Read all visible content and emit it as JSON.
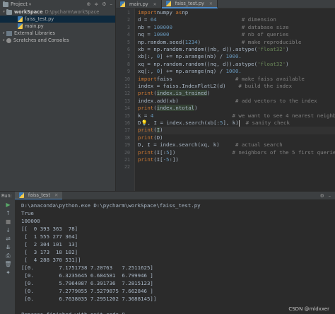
{
  "project": {
    "title": "Project",
    "tree": [
      {
        "label": "workSpace",
        "path": "D:\\pycharm\\workSpace",
        "type": "folder",
        "expanded": true,
        "bold": true
      },
      {
        "label": "faiss_test.py",
        "type": "py",
        "selected": true
      },
      {
        "label": "main.py",
        "type": "py"
      },
      {
        "label": "External Libraries",
        "type": "libs"
      },
      {
        "label": "Scratches and Consoles",
        "type": "scratch"
      }
    ]
  },
  "editor": {
    "tabs": [
      {
        "label": "main.py",
        "active": false
      },
      {
        "label": "faiss_test.py",
        "active": true
      }
    ],
    "current_line": 17,
    "lines": [
      [
        [
          "kw",
          "import"
        ],
        [
          "",
          "numpy "
        ],
        [
          "kw",
          "as"
        ],
        [
          "",
          "np"
        ]
      ],
      [
        [
          "",
          "d = "
        ],
        [
          "num",
          "64"
        ],
        [
          "",
          "                           "
        ],
        [
          "cm",
          "# dimension"
        ]
      ],
      [
        [
          "",
          "nb = "
        ],
        [
          "num",
          "100000"
        ],
        [
          "",
          "                      "
        ],
        [
          "cm",
          "# database size"
        ]
      ],
      [
        [
          "",
          "nq = "
        ],
        [
          "num",
          "10000"
        ],
        [
          "",
          "                       "
        ],
        [
          "cm",
          "# nb of queries"
        ]
      ],
      [
        [
          "",
          "np.random.seed("
        ],
        [
          "num",
          "1234"
        ],
        [
          "",
          ")             "
        ],
        [
          "cm",
          "# make reproducible"
        ]
      ],
      [
        [
          "",
          "xb = np.random.random((nb, d)).astype("
        ],
        [
          "str",
          "'float32'"
        ],
        [
          "",
          ")"
        ]
      ],
      [
        [
          "",
          "xb[:, "
        ],
        [
          "num",
          "0"
        ],
        [
          "",
          "] += np.arange(nb) / "
        ],
        [
          "num",
          "1000."
        ]
      ],
      [
        [
          "",
          "xq = np.random.random((nq, d)).astype("
        ],
        [
          "str",
          "'float32'"
        ],
        [
          "",
          ")"
        ]
      ],
      [
        [
          "",
          "xq[:, "
        ],
        [
          "num",
          "0"
        ],
        [
          "",
          "] += np.arange(nq) / "
        ],
        [
          "num",
          "1000."
        ]
      ],
      [
        [
          "kw",
          "import"
        ],
        [
          "",
          "faiss                    "
        ],
        [
          "cm",
          "# make faiss available"
        ]
      ],
      [
        [
          "",
          "index = faiss.IndexFlatL2(d)    "
        ],
        [
          "cm",
          "# build the index"
        ]
      ],
      [
        [
          "kw",
          "print"
        ],
        [
          "",
          "("
        ],
        [
          "hl",
          "index.is_trained"
        ],
        [
          "",
          ")"
        ]
      ],
      [
        [
          "",
          "index.add(xb)                  "
        ],
        [
          "cm",
          "# add vectors to the index"
        ]
      ],
      [
        [
          "kw",
          "print"
        ],
        [
          "",
          "("
        ],
        [
          "hl",
          "index.ntotal"
        ],
        [
          "",
          ")"
        ]
      ],
      [
        [
          "",
          "k = "
        ],
        [
          "num",
          "4"
        ],
        [
          "",
          "                         "
        ],
        [
          "cm",
          "# we want to see 4 nearest neighbors"
        ]
      ],
      [
        [
          "",
          "D"
        ],
        [
          "bulb",
          "💡"
        ],
        [
          "",
          ", I = index.search(xb[:"
        ],
        [
          "num",
          "5"
        ],
        [
          "",
          "], k)"
        ],
        [
          "caret",
          ""
        ],
        [
          "",
          "  "
        ],
        [
          "cm",
          "# sanity check"
        ]
      ],
      [
        [
          "kw",
          "print"
        ],
        [
          "",
          "("
        ],
        [
          "hl",
          "I"
        ],
        [
          "",
          ")"
        ]
      ],
      [
        [
          "kw",
          "print"
        ],
        [
          "",
          "(D)"
        ]
      ],
      [
        [
          "",
          "D, I = index.search(xq, k)     "
        ],
        [
          "cm",
          "# actual search"
        ]
      ],
      [
        [
          "kw",
          "print"
        ],
        [
          "",
          "(I[:"
        ],
        [
          "num",
          "5"
        ],
        [
          "",
          "])                  "
        ],
        [
          "cm",
          "# neighbors of the 5 first queries"
        ]
      ],
      [
        [
          "kw",
          "print"
        ],
        [
          "",
          "(I["
        ],
        [
          "num",
          "-5"
        ],
        [
          "",
          ":])"
        ]
      ],
      [
        [
          "",
          ""
        ]
      ]
    ]
  },
  "run": {
    "label": "Run:",
    "tab": "faiss_test",
    "output": [
      "D:\\anaconda\\python.exe D:\\pycharm\\workSpace\\faiss_test.py",
      "True",
      "100000",
      "[[  0 393 363  78]",
      " [  1 555 277 364]",
      " [  2 304 101  13]",
      " [  3 173  18 182]",
      " [  4 288 370 531]]",
      "[[0.        7.1751738 7.20763   7.2511625]",
      " [0.        6.3235645 6.684581  6.799946 ]",
      " [0.        5.7964087 6.391736  7.2815123]",
      " [0.        7.2779055 7.5279875 7.662846 ]",
      " [0.        6.7638035 7.2951202 7.3688145]]",
      "",
      "Process finished with exit code 0"
    ]
  },
  "watermark": "CSDN @mldxxer"
}
